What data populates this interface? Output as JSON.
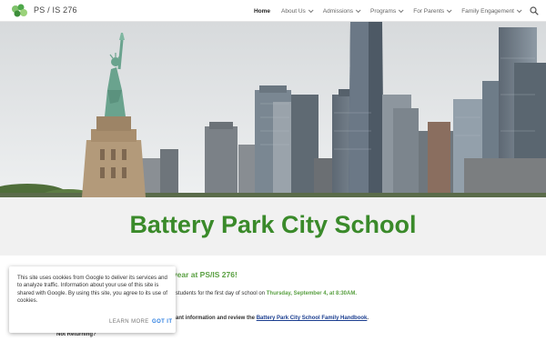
{
  "site": {
    "title": "PS / IS 276"
  },
  "nav": {
    "items": [
      {
        "label": "Home",
        "active": true,
        "dropdown": false
      },
      {
        "label": "About Us",
        "active": false,
        "dropdown": true
      },
      {
        "label": "Admissions",
        "active": false,
        "dropdown": true
      },
      {
        "label": "Programs",
        "active": false,
        "dropdown": true
      },
      {
        "label": "For Parents",
        "active": false,
        "dropdown": true
      },
      {
        "label": "Family Engagement",
        "active": false,
        "dropdown": true
      }
    ],
    "search_icon": "search-icon"
  },
  "hero": {
    "description_icon": "nyc-skyline-image"
  },
  "page": {
    "school_title": "Battery Park City School",
    "welcome_fragment": "ol year at PS/IS 276!",
    "line1_prefix": "students for the first day of school on ",
    "line1_date": "Thursday, September 4, at 8:30AM.",
    "line2_prefix": "ant information and review the ",
    "line2_link": "Battery Park City School Family Handbook",
    "line2_suffix": ".",
    "not_returning": "Not Returning?"
  },
  "cookie": {
    "text": "This site uses cookies from Google to deliver its services and to analyze traffic. Information about your use of this site is shared with Google. By using this site, you agree to its use of cookies.",
    "learn_more": "LEARN MORE",
    "got_it": "GOT IT"
  },
  "colors": {
    "title_green": "#3a8a2a",
    "accent_green": "#5aa042",
    "link_blue": "#1a3d8f",
    "button_blue": "#2a7de1",
    "band_gray": "#f1f1f1"
  }
}
